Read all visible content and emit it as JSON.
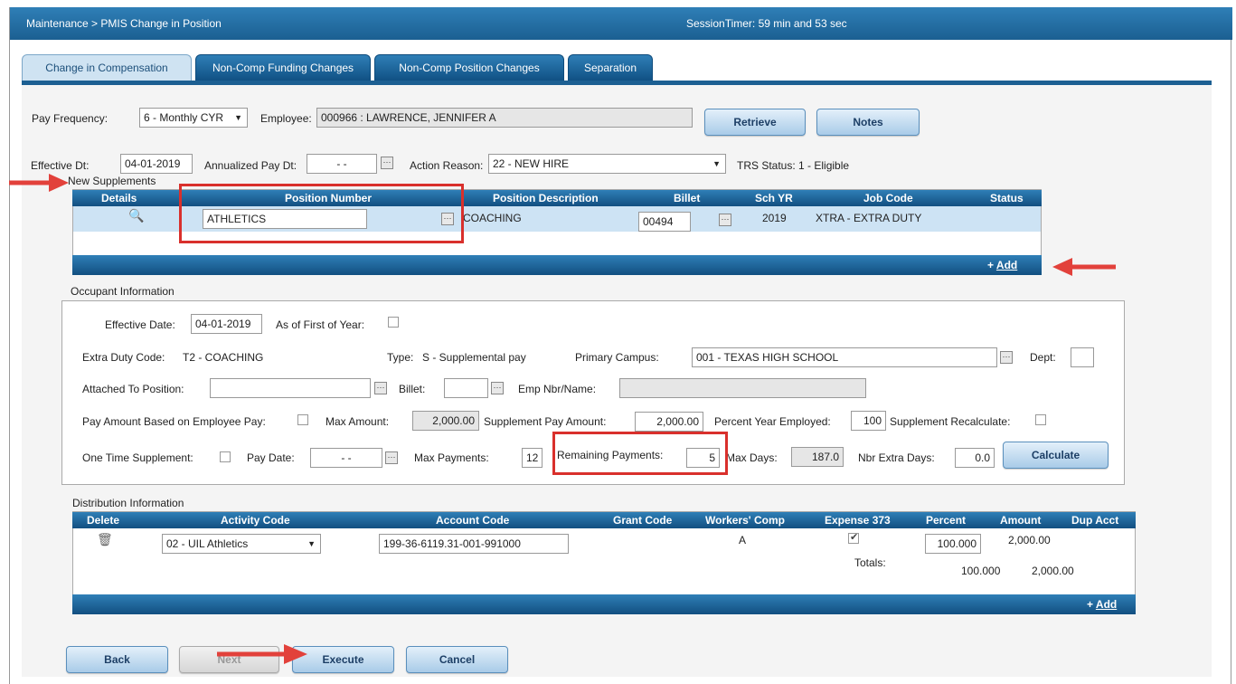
{
  "titlebar": {
    "breadcrumb": "Maintenance > PMIS Change in Position",
    "session_timer": "SessionTimer: 59 min and 53 sec"
  },
  "tabs": [
    {
      "label": "Change in Compensation"
    },
    {
      "label": "Non-Comp Funding Changes"
    },
    {
      "label": "Non-Comp Position Changes"
    },
    {
      "label": "Separation"
    }
  ],
  "header": {
    "pay_frequency_label": "Pay Frequency:",
    "pay_frequency_value": "6 - Monthly CYR",
    "employee_label": "Employee:",
    "employee_value": "000966 : LAWRENCE, JENNIFER A",
    "retrieve_label": "Retrieve",
    "notes_label": "Notes",
    "effective_dt_label": "Effective Dt:",
    "effective_dt_value": "04-01-2019",
    "annualized_label": "Annualized Pay Dt:",
    "annualized_value": "- -",
    "action_reason_label": "Action Reason:",
    "action_reason_value": "22 - NEW HIRE",
    "trs_status": "TRS Status: 1 - Eligible"
  },
  "supplements": {
    "title": "New Supplements",
    "columns": [
      "Details",
      "Position Number",
      "Position Description",
      "Billet",
      "Sch YR",
      "Job Code",
      "Status"
    ],
    "row": {
      "position_number": "ATHLETICS",
      "position_description": "COACHING",
      "billet": "00494",
      "sch_yr": "2019",
      "job_code": "XTRA - EXTRA DUTY"
    },
    "add_label": "Add"
  },
  "occupant": {
    "title": "Occupant Information",
    "effective_date_label": "Effective Date:",
    "effective_date_value": "04-01-2019",
    "as_of_first_label": "As of First of Year:",
    "extra_duty_label": "Extra Duty Code:",
    "extra_duty_value": "T2 - COACHING",
    "type_label": "Type:",
    "type_value": "S - Supplemental pay",
    "primary_campus_label": "Primary Campus:",
    "primary_campus_value": "001 - TEXAS HIGH SCHOOL",
    "dept_label": "Dept:",
    "attached_label": "Attached To Position:",
    "billet_label": "Billet:",
    "emp_nbr_label": "Emp Nbr/Name:",
    "pay_based_label": "Pay Amount Based on Employee Pay:",
    "max_amount_label": "Max Amount:",
    "max_amount_value": "2,000.00",
    "supp_pay_label": "Supplement Pay Amount:",
    "supp_pay_value": "2,000.00",
    "pct_year_label": "Percent Year Employed:",
    "pct_year_value": "100",
    "supp_recalc_label": "Supplement Recalculate:",
    "one_time_label": "One Time Supplement:",
    "pay_date_label": "Pay Date:",
    "pay_date_value": "- -",
    "max_payments_label": "Max Payments:",
    "max_payments_value": "12",
    "remaining_label": "Remaining Payments:",
    "remaining_value": "5",
    "max_days_label": "Max Days:",
    "max_days_value": "187.0",
    "extra_days_label": "Nbr Extra Days:",
    "extra_days_value": "0.0",
    "calculate_label": "Calculate"
  },
  "distribution": {
    "title": "Distribution Information",
    "columns": [
      "Delete",
      "Activity Code",
      "Account Code",
      "Grant Code",
      "Workers' Comp",
      "Expense 373",
      "Percent",
      "Amount",
      "Dup Acct"
    ],
    "row": {
      "activity_code": "02 - UIL Athletics",
      "account_code": "199-36-6119.31-001-991000",
      "workers_comp": "A",
      "percent": "100.000",
      "amount": "2,000.00"
    },
    "totals_label": "Totals:",
    "totals_percent": "100.000",
    "totals_amount": "2,000.00",
    "add_label": "Add"
  },
  "footer": {
    "back_label": "Back",
    "next_label": "Next",
    "execute_label": "Execute",
    "cancel_label": "Cancel"
  },
  "colors": {
    "header_blue": "#1b5f91",
    "highlight_red": "#d9302c"
  }
}
